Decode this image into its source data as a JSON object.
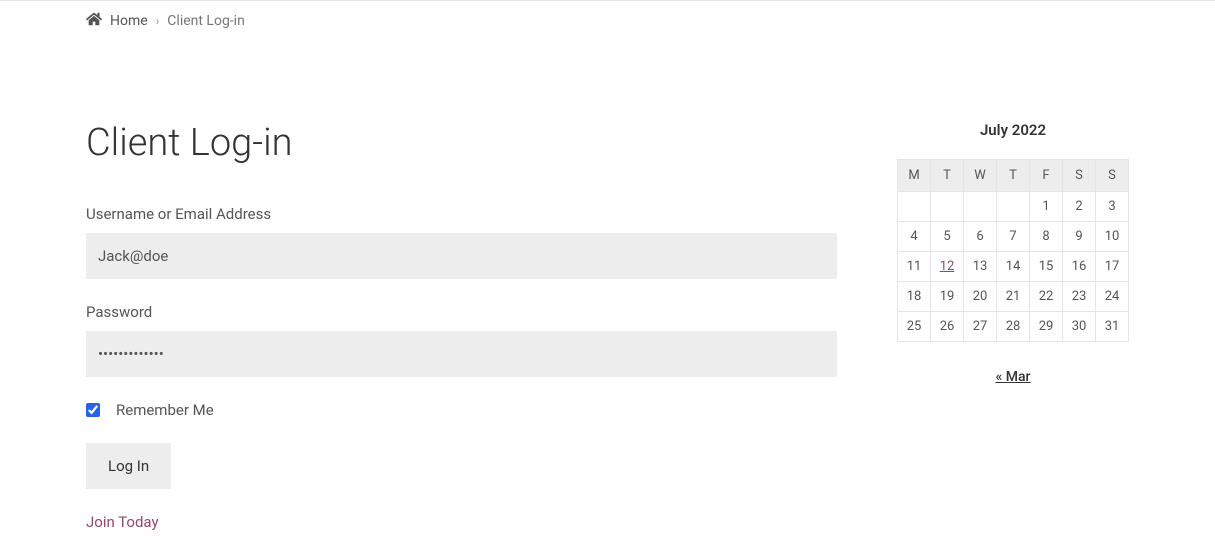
{
  "breadcrumb": {
    "home": "Home",
    "current": "Client Log-in"
  },
  "page": {
    "title": "Client Log-in"
  },
  "form": {
    "username_label": "Username or Email Address",
    "username_value": "Jack@doe",
    "password_label": "Password",
    "password_value": "•••••••••••••",
    "remember_label": "Remember Me",
    "login_button": "Log In",
    "join_link": "Join Today"
  },
  "calendar": {
    "title": "July 2022",
    "days": [
      "M",
      "T",
      "W",
      "T",
      "F",
      "S",
      "S"
    ],
    "weeks": [
      [
        "",
        "",
        "",
        "",
        "1",
        "2",
        "3"
      ],
      [
        "4",
        "5",
        "6",
        "7",
        "8",
        "9",
        "10"
      ],
      [
        "11",
        "12",
        "13",
        "14",
        "15",
        "16",
        "17"
      ],
      [
        "18",
        "19",
        "20",
        "21",
        "22",
        "23",
        "24"
      ],
      [
        "25",
        "26",
        "27",
        "28",
        "29",
        "30",
        "31"
      ]
    ],
    "linked_day": "12",
    "prev_nav": "« Mar"
  }
}
